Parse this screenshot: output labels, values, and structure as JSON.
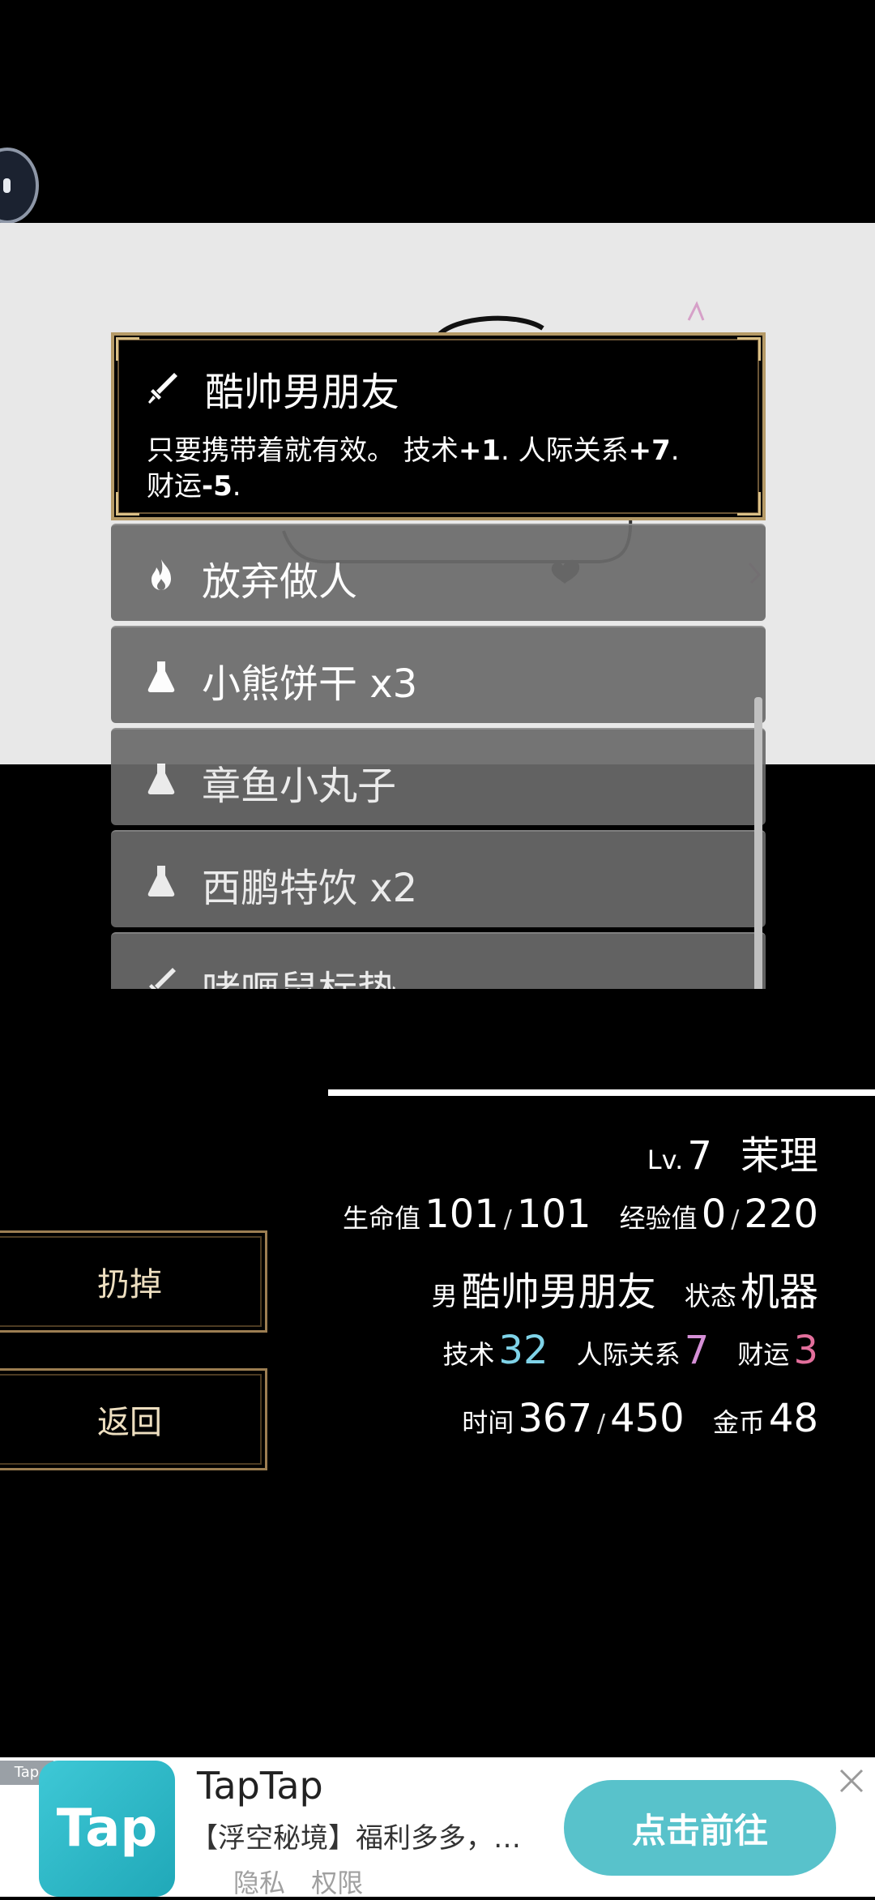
{
  "selected_item": {
    "icon": "sword-icon",
    "name": "酷帅男朋友",
    "desc_prefix": "只要携带着就有效。  技术",
    "skill_bonus": "+1",
    "sep1": ". 人际关系",
    "social_bonus": "+7",
    "sep2": ".",
    "luck_label": "财运",
    "luck_bonus": "-5",
    "end": "."
  },
  "items": [
    {
      "icon": "flame-icon",
      "label": "放弃做人"
    },
    {
      "icon": "potion-icon",
      "label": "小熊饼干 x3"
    },
    {
      "icon": "potion-icon",
      "label": "章鱼小丸子"
    },
    {
      "icon": "potion-icon",
      "label": "西鹏特饮 x2"
    },
    {
      "icon": "sword-icon",
      "label": "啫喱鼠标垫"
    }
  ],
  "buttons": {
    "discard": "扔掉",
    "back": "返回"
  },
  "stats": {
    "lv_label": "Lv.",
    "lv": "7",
    "name": "茉理",
    "hp_label": "生命值",
    "hp": "101",
    "hp_max": "101",
    "exp_label": "经验值",
    "exp": "0",
    "exp_max": "220",
    "gender": "男",
    "equipped": "酷帅男朋友",
    "status_label": "状态",
    "status": "机器",
    "skill_label": "技术",
    "skill": "32",
    "social_label": "人际关系",
    "social": "7",
    "luck_label": "财运",
    "luck": "3",
    "time_label": "时间",
    "time": "367",
    "time_max": "450",
    "gold_label": "金币",
    "gold": "48",
    "slash": "/"
  },
  "colors": {
    "skill": "#7fd3e8",
    "social": "#d58fd6",
    "luck": "#e36f9c",
    "frame": "#b59a67",
    "cta": "#58c2cb"
  },
  "ad": {
    "tag": "Tap",
    "logo_text": "Tap",
    "title": "TapTap",
    "desc": "【浮空秘境】福利多多，轻...",
    "privacy": "隐私",
    "permission": "权限",
    "cta": "点击前往"
  }
}
